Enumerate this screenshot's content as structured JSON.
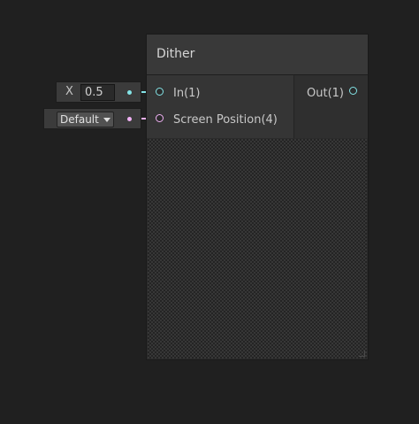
{
  "node": {
    "title": "Dither",
    "inputs": [
      {
        "label": "In(1)",
        "color": "#84e4e7"
      },
      {
        "label": "Screen Position(4)",
        "color": "#f1b1f5"
      }
    ],
    "outputs": [
      {
        "label": "Out(1)",
        "color": "#84e4e7"
      }
    ]
  },
  "input_fields": {
    "x_field": {
      "label": "X",
      "value": "0.5"
    },
    "screen_position": {
      "selected": "Default"
    }
  },
  "colors": {
    "background": "#202020",
    "vector1_port": "#84e4e7",
    "vector4_port": "#f1b1f5"
  }
}
